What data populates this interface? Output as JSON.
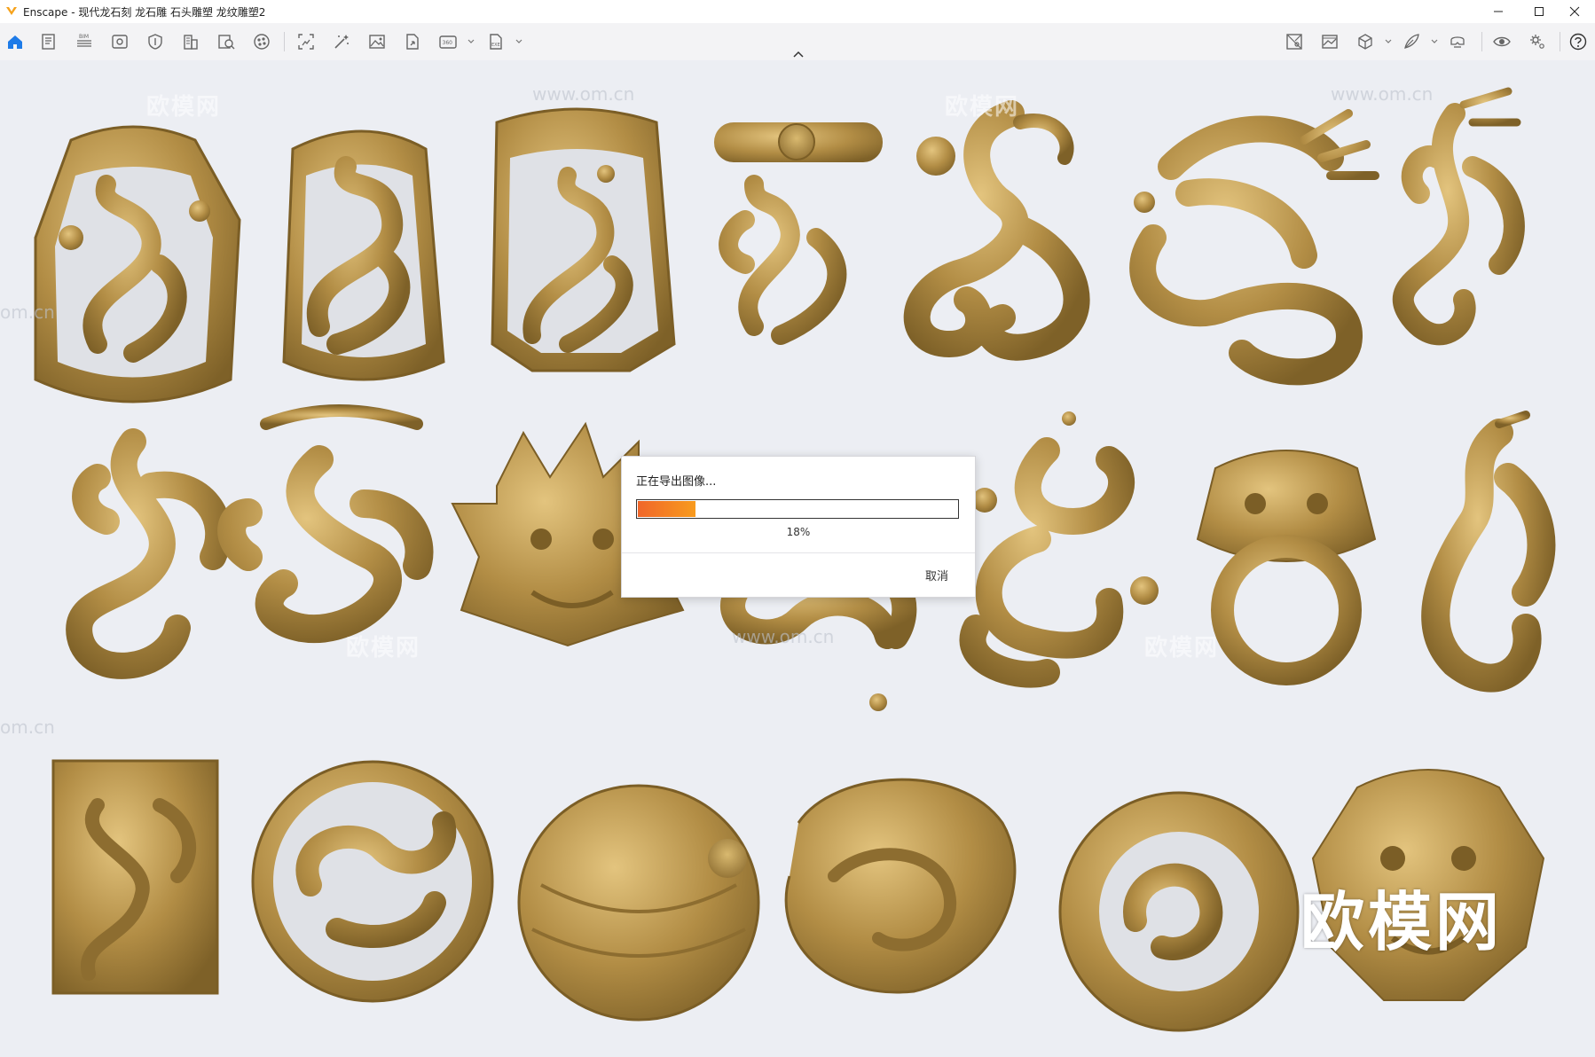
{
  "window": {
    "title": "Enscape - 现代龙石刻 龙石雕 石头雕塑 龙纹雕塑2",
    "controls": [
      "minimize-icon",
      "maximize-icon",
      "close-icon"
    ]
  },
  "toolbar": {
    "left_icons": [
      "home-icon",
      "document-icon",
      "bim-icon",
      "view-icon",
      "shield-icon",
      "building-icon",
      "asset-library-icon",
      "material-icon",
      "screenshot-icon",
      "magic-wand-icon",
      "image-icon",
      "export-icon",
      "panorama-360-icon",
      "exe-export-icon"
    ],
    "bim_label": "BIM",
    "pano_label": "360",
    "exe_label": "EXE",
    "right_icons": [
      "map-icon",
      "gallery-icon",
      "cube-icon",
      "feather-icon",
      "vr-headset-icon",
      "eye-icon",
      "settings-icon",
      "help-icon"
    ],
    "accent_color": "#1e7be8"
  },
  "viewport": {
    "watermark_brand": "欧模网",
    "watermark_url": "www.om.cn",
    "watermark_edge": "om.cn",
    "carving_color": "#b28d45"
  },
  "dialog": {
    "title": "正在导出图像...",
    "progress_percent": 18,
    "progress_label": "18%",
    "cancel_label": "取消"
  }
}
